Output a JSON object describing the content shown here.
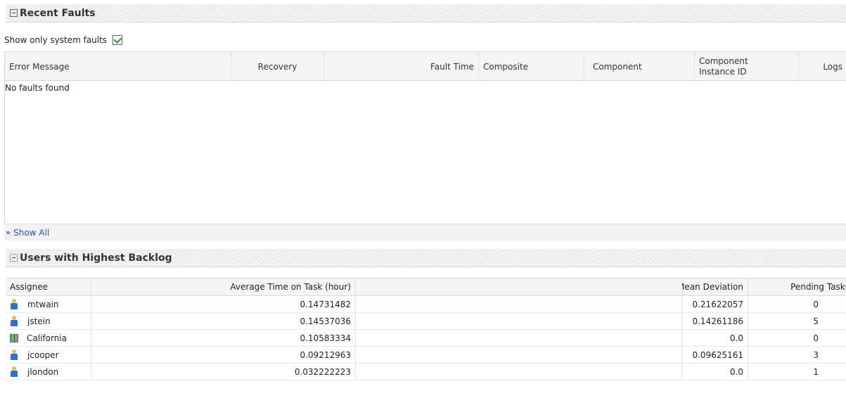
{
  "recent_faults": {
    "title": "Recent Faults",
    "filter_label": "Show only system faults",
    "filter_checked": true,
    "columns": [
      "Error Message",
      "Recovery",
      "Fault Time",
      "Composite",
      "Component",
      "Component Instance ID",
      "Logs"
    ],
    "column_instance_line1": "Component",
    "column_instance_line2": "Instance ID",
    "empty_message": "No faults found",
    "show_all": "Show All"
  },
  "backlog": {
    "title": "Users with Highest Backlog",
    "columns": {
      "assignee": "Assignee",
      "avg_time": "Average Time on Task (hour)",
      "mean_dev": "Mean Deviation",
      "pending": "Pending Tasks"
    },
    "rows": [
      {
        "assignee": "mtwain",
        "type": "user",
        "avg_time": "0.14731482",
        "mean_dev": "0.21622057",
        "pending": "0"
      },
      {
        "assignee": "jstein",
        "type": "user",
        "avg_time": "0.14537036",
        "mean_dev": "0.14261186",
        "pending": "5"
      },
      {
        "assignee": "California",
        "type": "group",
        "avg_time": "0.10583334",
        "mean_dev": "0.0",
        "pending": "0"
      },
      {
        "assignee": "jcooper",
        "type": "user",
        "avg_time": "0.09212963",
        "mean_dev": "0.09625161",
        "pending": "3"
      },
      {
        "assignee": "jlondon",
        "type": "user",
        "avg_time": "0.032222223",
        "mean_dev": "0.0",
        "pending": "1"
      }
    ]
  },
  "icons": {
    "collapse": "collapse-icon",
    "show_all": "double-chevron-right-icon",
    "user": "user-icon",
    "group": "group-icon"
  }
}
